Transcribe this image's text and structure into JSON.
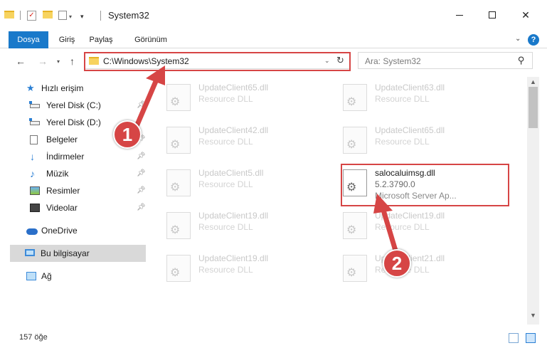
{
  "window": {
    "title": "System32",
    "icons": [
      "folder-icon",
      "properties-check-icon",
      "new-folder-icon",
      "properties-icon"
    ]
  },
  "ribbon": {
    "tabs": [
      {
        "label": "Dosya",
        "active": true
      },
      {
        "label": "Giriş"
      },
      {
        "label": "Paylaş"
      },
      {
        "label": "Görünüm"
      }
    ],
    "help": "?"
  },
  "nav": {
    "address": "C:\\Windows\\System32",
    "search_placeholder": "Ara: System32"
  },
  "sidebar": {
    "items": [
      {
        "label": "Hızlı erişim",
        "icon": "star-icon"
      },
      {
        "label": "Yerel Disk (C:)",
        "icon": "drive-icon",
        "pinned": true
      },
      {
        "label": "Yerel Disk (D:)",
        "icon": "drive-icon"
      },
      {
        "label": "Belgeler",
        "icon": "documents-icon",
        "pinned": true
      },
      {
        "label": "İndirmeler",
        "icon": "downloads-icon",
        "pinned": true
      },
      {
        "label": "Müzik",
        "icon": "music-icon",
        "pinned": true
      },
      {
        "label": "Resimler",
        "icon": "pictures-icon",
        "pinned": true
      },
      {
        "label": "Videolar",
        "icon": "videos-icon",
        "pinned": true
      },
      {
        "label": "OneDrive",
        "icon": "onedrive-icon"
      },
      {
        "label": "Bu bilgisayar",
        "icon": "this-pc-icon",
        "selected": true
      },
      {
        "label": "Ağ",
        "icon": "network-icon"
      }
    ]
  },
  "files": [
    {
      "name": "UpdateClient65.dll",
      "desc": "Resource DLL"
    },
    {
      "name": "UpdateClient63.dll",
      "desc": "Resource DLL"
    },
    {
      "name": "UpdateClient42.dll",
      "desc": "Resource DLL"
    },
    {
      "name": "UpdateClient65.dll",
      "desc": "Resource DLL"
    },
    {
      "name": "UpdateClient5.dll",
      "desc": "Resource DLL"
    },
    {
      "name": "salocaluimsg.dll",
      "version": "5.2.3790.0",
      "desc": "Microsoft Server Ap...",
      "highlighted": true
    },
    {
      "name": "UpdateClient19.dll",
      "desc": "Resource DLL"
    },
    {
      "name": "UpdateClient19.dll",
      "desc": "Resource DLL"
    },
    {
      "name": "UpdateClient19.dll",
      "desc": "Resource DLL"
    },
    {
      "name": "UpdateClient21.dll",
      "desc": "Resource DLL"
    }
  ],
  "status": {
    "item_count": "157 öğe"
  },
  "callouts": [
    "1",
    "2"
  ],
  "colors": {
    "accent": "#1979ca",
    "highlight": "#d64545",
    "selected_bg": "#d9d9d9"
  }
}
